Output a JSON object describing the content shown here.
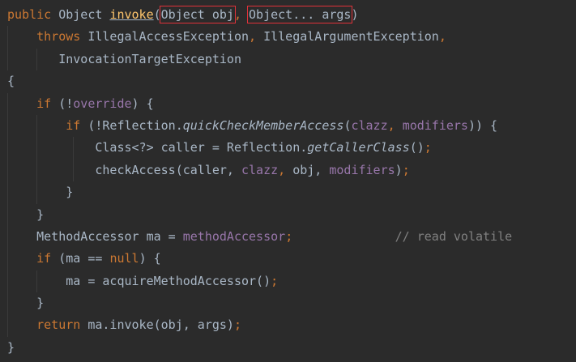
{
  "code": {
    "l1": {
      "public": "public",
      "type": "Object",
      "method": "invoke",
      "open": "(",
      "param1": "Object obj",
      "comma": ",",
      "param2": "Object... args",
      "close": ")"
    },
    "l2": {
      "throws": "throws",
      "ex1": "IllegalAccessException",
      "comma1": ",",
      "ex2": "IllegalArgumentException",
      "comma2": ","
    },
    "l3": {
      "ex3": "InvocationTargetException"
    },
    "l4": {
      "brace": "{"
    },
    "l5": {
      "if": "if",
      "open": "(!",
      "field": "override",
      "close": ") {"
    },
    "l6": {
      "if": "if",
      "open": "(!Reflection.",
      "method": "quickCheckMemberAccess",
      "paren": "(",
      "arg1": "clazz",
      "comma": ",",
      "arg2": "modifiers",
      "close": ")) {"
    },
    "l7": {
      "decl": "Class<?> caller = Reflection.",
      "method": "getCallerClass",
      "parens": "()",
      "semi": ";"
    },
    "l8": {
      "call": "checkAccess(caller,",
      "arg": "clazz",
      "comma1": ",",
      "obj": "obj,",
      "mods": "modifiers",
      "close": ")",
      "semi": ";"
    },
    "l9": {
      "brace": "}"
    },
    "l10": {
      "brace": "}"
    },
    "l11": {
      "decl": "MethodAccessor ma = ",
      "field": "methodAccessor",
      "semi": ";",
      "comment": "// read volatile"
    },
    "l12": {
      "if": "if",
      "open": "(ma == ",
      "null": "null",
      "close": ") {"
    },
    "l13": {
      "assign": "ma = acquireMethodAccessor()",
      "semi": ";"
    },
    "l14": {
      "brace": "}"
    },
    "l15": {
      "return": "return",
      "expr": "ma.invoke(obj, args)",
      "semi": ";"
    },
    "l16": {
      "brace": "}"
    }
  }
}
